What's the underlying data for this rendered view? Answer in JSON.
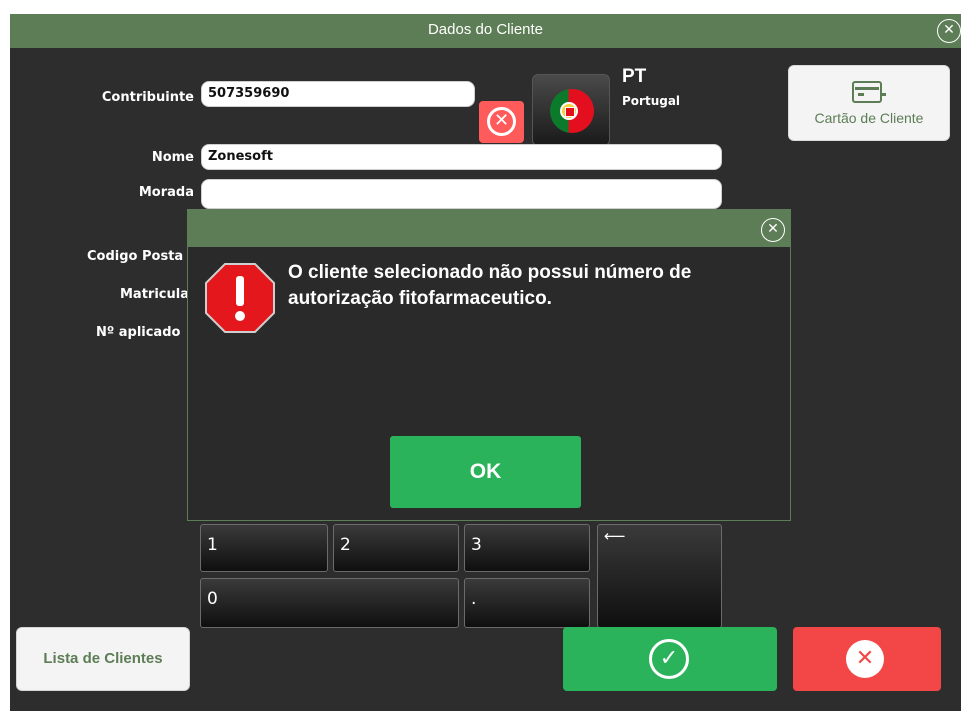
{
  "window": {
    "title": "Dados do Cliente",
    "close_icon": "close-circle-icon"
  },
  "form": {
    "labels": {
      "contribuinte": "Contribuinte",
      "nome": "Nome",
      "morada": "Morada",
      "codigo_postal": "Codigo Posta",
      "matricula": "Matricula",
      "n_aplicador": "Nº aplicado"
    },
    "values": {
      "contribuinte": "507359690",
      "nome": "Zonesoft",
      "morada": ""
    },
    "clear_icon": "clear-x-icon"
  },
  "country": {
    "code": "PT",
    "name": "Portugal",
    "flag_icon": "portugal-flag-icon"
  },
  "card_button": {
    "label": "Cartão de Cliente",
    "icon": "id-card-icon"
  },
  "keypad": {
    "keys": [
      "1",
      "2",
      "3",
      "0",
      "."
    ],
    "enter_icon": "enter-arrow-icon",
    "enter_glyph": "⟵"
  },
  "footer": {
    "list_label": "Lista de Clientes",
    "confirm_icon": "check-circle-icon",
    "cancel_icon": "cancel-circle-icon"
  },
  "dialog": {
    "message": "O cliente selecionado não possui número de autorização fitofarmaceutico.",
    "ok_label": "OK",
    "warning_icon": "warning-octagon-icon",
    "close_icon": "close-circle-icon"
  },
  "colors": {
    "title_bar": "#5d7d56",
    "background": "#2d2d2d",
    "confirm": "#2bb35b",
    "cancel": "#f34747",
    "clear": "#ff5b5b",
    "warning": "#e3171c"
  }
}
